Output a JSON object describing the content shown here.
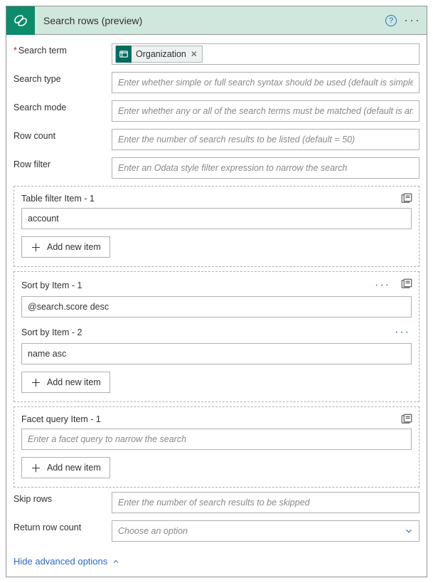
{
  "header": {
    "title": "Search rows (preview)"
  },
  "fields": {
    "search_term": {
      "label": "Search term",
      "token": "Organization"
    },
    "search_type": {
      "label": "Search type",
      "placeholder": "Enter whether simple or full search syntax should be used (default is simple)"
    },
    "search_mode": {
      "label": "Search mode",
      "placeholder": "Enter whether any or all of the search terms must be matched (default is any)"
    },
    "row_count": {
      "label": "Row count",
      "placeholder": "Enter the number of search results to be listed (default = 50)"
    },
    "row_filter": {
      "label": "Row filter",
      "placeholder": "Enter an Odata style filter expression to narrow the search"
    },
    "skip_rows": {
      "label": "Skip rows",
      "placeholder": "Enter the number of search results to be skipped"
    },
    "return_row_count": {
      "label": "Return row count",
      "placeholder": "Choose an option"
    }
  },
  "table_filter": {
    "label": "Table filter Item - 1",
    "value": "account",
    "add_label": "Add new item"
  },
  "sort_by": {
    "item1_label": "Sort by Item - 1",
    "item1_value": "@search.score desc",
    "item2_label": "Sort by Item - 2",
    "item2_value": "name asc",
    "add_label": "Add new item"
  },
  "facet": {
    "label": "Facet query Item - 1",
    "placeholder": "Enter a facet query to narrow the search",
    "add_label": "Add new item"
  },
  "advanced_link": "Hide advanced options"
}
